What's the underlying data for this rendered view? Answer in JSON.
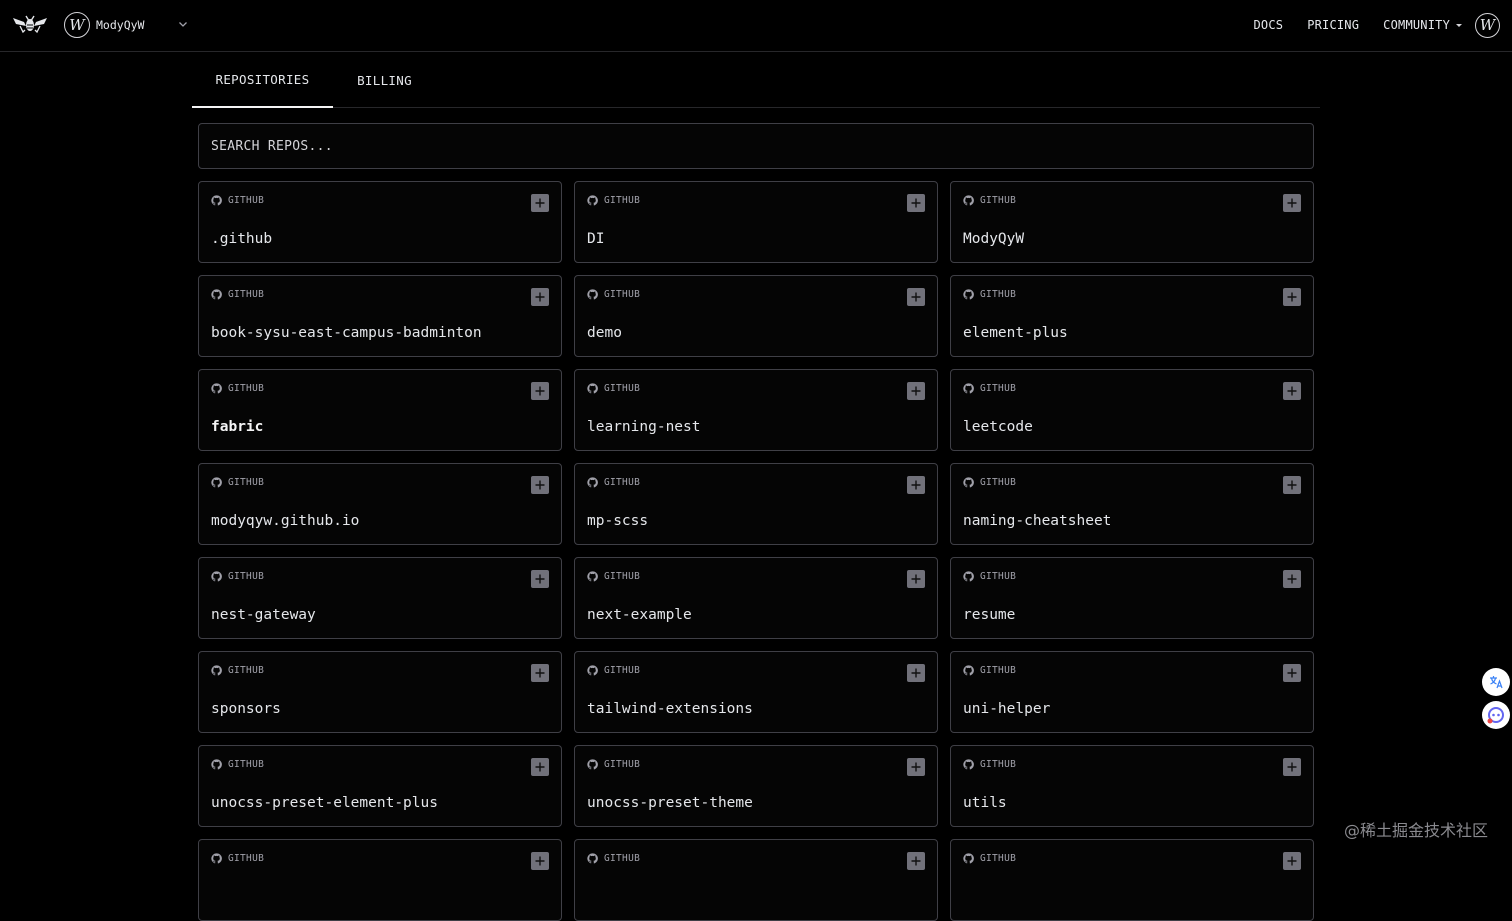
{
  "header": {
    "account_name": "ModyQyW",
    "avatar_letter": "W",
    "nav": {
      "docs": "DOCS",
      "pricing": "PRICING",
      "community": "COMMUNITY"
    }
  },
  "tabs": {
    "repositories": "REPOSITORIES",
    "billing": "BILLING",
    "active": "repositories"
  },
  "search": {
    "placeholder": "SEARCH REPOS...",
    "value": ""
  },
  "repos": {
    "source_label": "GITHUB",
    "items": [
      ".github",
      "DI",
      "ModyQyW",
      "book-sysu-east-campus-badminton",
      "demo",
      "element-plus",
      "fabric",
      "learning-nest",
      "leetcode",
      "modyqyw.github.io",
      "mp-scss",
      "naming-cheatsheet",
      "nest-gateway",
      "next-example",
      "resume",
      "sponsors",
      "tailwind-extensions",
      "uni-helper",
      "unocss-preset-element-plus",
      "unocss-preset-theme",
      "utils",
      "",
      "",
      ""
    ]
  },
  "watermark": "@稀土掘金技术社区",
  "colors": {
    "background": "#000000",
    "border": "#3f3f46",
    "text": "#e5e7eb",
    "add_button": "#71717a"
  },
  "icons": {
    "logo": "bee-logo-icon",
    "source": "github-icon",
    "add": "plus-icon",
    "translate": "translate-icon",
    "assistant": "assistant-icon"
  }
}
